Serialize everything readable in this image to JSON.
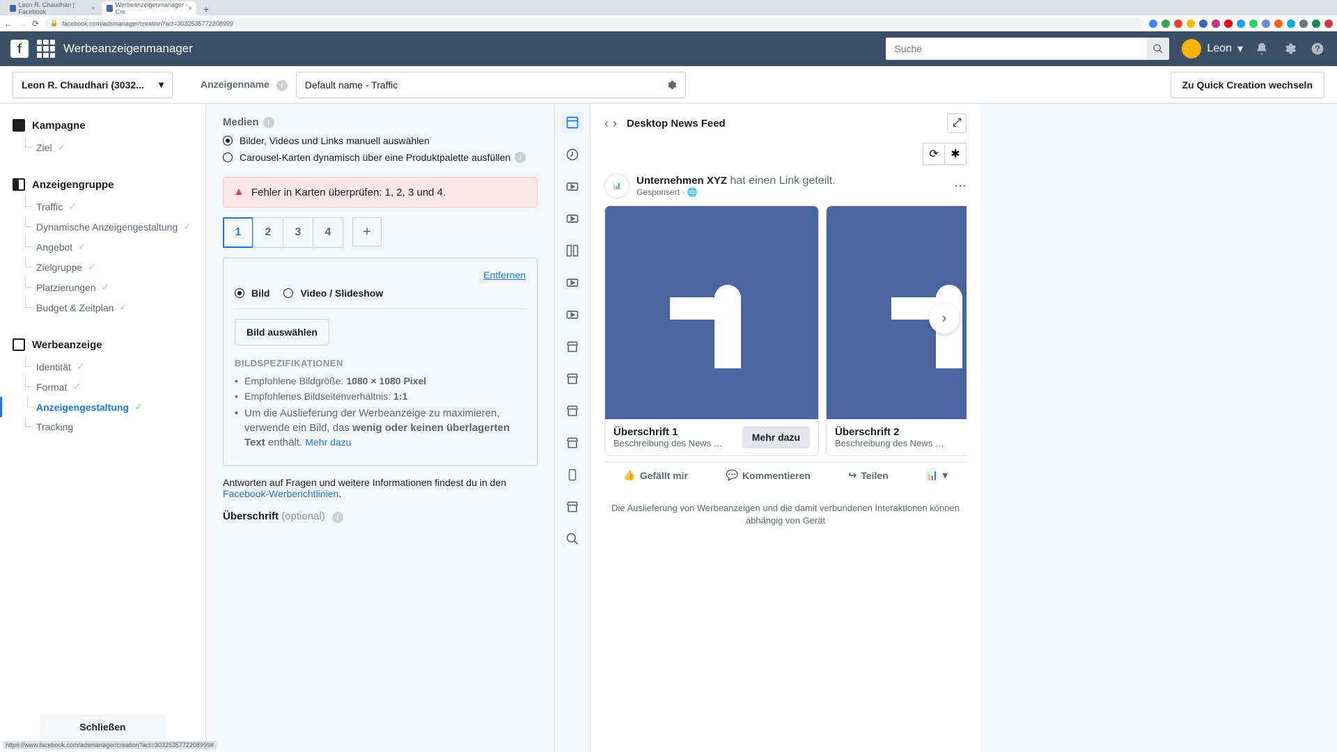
{
  "browser": {
    "tab1": "Leon R. Chaudhari | Facebook",
    "tab2": "Werbeanzeigenmanager - Cre",
    "url": "facebook.com/adsmanager/creation?act=3032535772208999",
    "status_url": "https://www.facebook.com/adsmanager/creation?act=3032535772208999#"
  },
  "header": {
    "app_title": "Werbeanzeigenmanager",
    "search_placeholder": "Suche",
    "user_name": "Leon"
  },
  "topbar": {
    "account": "Leon R. Chaudhari (3032...",
    "name_label": "Anzeigenname",
    "name_value": "Default name - Traffic",
    "quick_btn": "Zu Quick Creation wechseln"
  },
  "sidebar": {
    "campaign_head": "Kampagne",
    "campaign_items": [
      "Ziel"
    ],
    "adset_head": "Anzeigengruppe",
    "adset_items": [
      "Traffic",
      "Dynamische Anzeigengestaltung",
      "Angebot",
      "Zielgruppe",
      "Platzierungen",
      "Budget & Zeitplan"
    ],
    "ad_head": "Werbeanzeige",
    "ad_items": [
      "Identität",
      "Format",
      "Anzeigengestaltung",
      "Tracking"
    ],
    "close": "Schließen"
  },
  "form": {
    "media_head": "Medien",
    "radio1": "Bilder, Videos und Links manuell auswählen",
    "radio2": "Carousel-Karten dynamisch über eine Produktpalette ausfüllen",
    "error": "Fehler in Karten überprüfen: 1, 2, 3 und 4.",
    "tabs": [
      "1",
      "2",
      "3",
      "4"
    ],
    "remove": "Entfernen",
    "media_type1": "Bild",
    "media_type2": "Video / Slideshow",
    "select_image": "Bild auswählen",
    "spec_head": "BILDSPEZIFIKATIONEN",
    "spec1_label": "Empfohlene Bildgröße: ",
    "spec1_value": "1080 × 1080 Pixel",
    "spec2_label": "Empfohlenes Bildseitenverhältnis: ",
    "spec2_value": "1:1",
    "spec3a": "Um die Auslieferung der Werbeanzeige zu maximieren, verwende ein Bild, das ",
    "spec3b": "wenig oder keinen überlagerten Text",
    "spec3c": " enthält. ",
    "learn_more": "Mehr dazu",
    "footer1": "Antworten auf Fragen und weitere Informationen findest du in den ",
    "footer_link": "Facebook-Werberichtlinien",
    "headline_label": "Überschrift ",
    "optional": "(optional)"
  },
  "preview": {
    "title": "Desktop News Feed",
    "page_name": "Unternehmen XYZ",
    "page_action": " hat einen Link geteilt.",
    "sponsored": "Gesponsert · 🌐",
    "card1_title": "Überschrift 1",
    "card1_desc": "Beschreibung des News …",
    "card1_cta": "Mehr dazu",
    "card2_title": "Überschrift 2",
    "card2_desc": "Beschreibung des News …",
    "like": "Gefällt mir",
    "comment": "Kommentieren",
    "share": "Teilen",
    "disclaimer": "Die Auslieferung von Werbeanzeigen und die damit verbundenen Interaktionen können abhängig von Gerät"
  }
}
